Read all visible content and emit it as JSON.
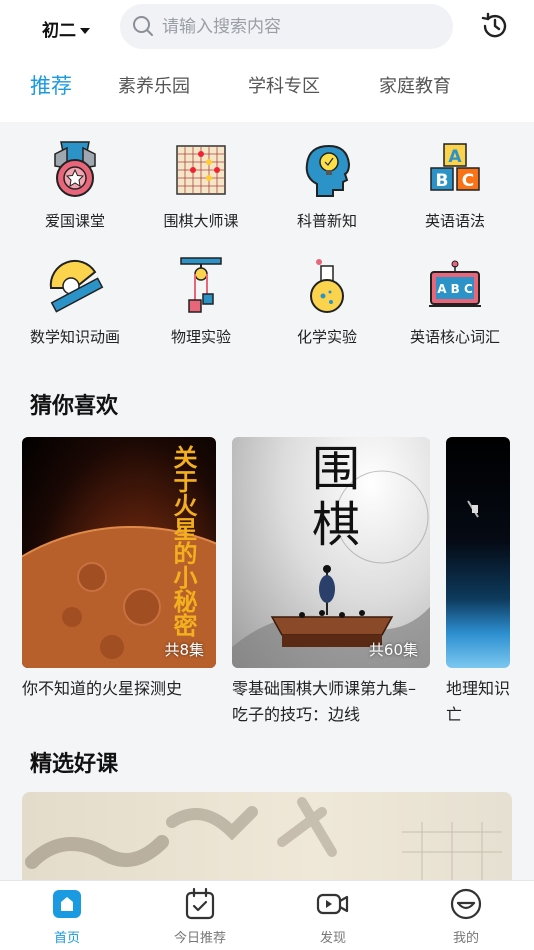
{
  "header": {
    "grade": "初二",
    "search_placeholder": "请输入搜索内容"
  },
  "tabs": [
    {
      "label": "推荐",
      "active": true
    },
    {
      "label": "素养乐园",
      "active": false
    },
    {
      "label": "学科专区",
      "active": false
    },
    {
      "label": "家庭教育",
      "active": false
    }
  ],
  "categories": [
    {
      "label": "爱国课堂",
      "icon": "medal-icon"
    },
    {
      "label": "围棋大师课",
      "icon": "go-board-icon"
    },
    {
      "label": "科普新知",
      "icon": "head-bulb-icon"
    },
    {
      "label": "英语语法",
      "icon": "abc-blocks-icon"
    },
    {
      "label": "数学知识动画",
      "icon": "protractor-icon"
    },
    {
      "label": "物理实验",
      "icon": "pulley-icon"
    },
    {
      "label": "化学实验",
      "icon": "flask-icon"
    },
    {
      "label": "英语核心词汇",
      "icon": "abc-board-icon"
    }
  ],
  "sections": {
    "guess": "猜你喜欢",
    "featured": "精选好课"
  },
  "cards": [
    {
      "title": "你不知道的火星探测史",
      "episodes": "共8集",
      "cover_text": "关于火星的小秘密"
    },
    {
      "title": "零基础围棋大师课第九集–吃子的技巧：边线",
      "episodes": "共60集",
      "cover_text": "围棋"
    },
    {
      "title": "地理知识亡",
      "episodes": "",
      "cover_text": ""
    }
  ],
  "bottom_nav": [
    {
      "label": "首页",
      "icon": "home-icon",
      "active": true
    },
    {
      "label": "今日推荐",
      "icon": "calendar-check-icon",
      "active": false
    },
    {
      "label": "发现",
      "icon": "video-icon",
      "active": false
    },
    {
      "label": "我的",
      "icon": "smile-face-icon",
      "active": false
    }
  ],
  "colors": {
    "accent": "#1a9ae0",
    "background": "#f4f5f7"
  }
}
